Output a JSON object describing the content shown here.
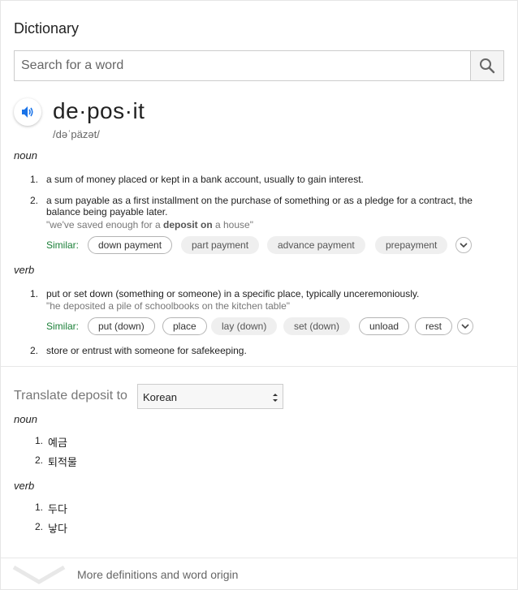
{
  "dictionary": {
    "title": "Dictionary",
    "search": {
      "placeholder": "Search for a word",
      "value": ""
    },
    "word": "de·pos·it",
    "phonetic": "/dəˈpäzət/",
    "noun": {
      "label": "noun",
      "defs": [
        {
          "num": "1.",
          "text": "a sum of money placed or kept in a bank account, usually to gain interest."
        },
        {
          "num": "2.",
          "text": "a sum payable as a first installment on the purchase of something or as a pledge for a contract, the balance being payable later.",
          "example_pre": "\"we've saved enough for a ",
          "example_bold": "deposit on",
          "example_post": " a house\"",
          "similar_label": "Similar:",
          "similar": [
            "down payment",
            "part payment",
            "advance payment",
            "prepayment"
          ]
        }
      ]
    },
    "verb": {
      "label": "verb",
      "defs": [
        {
          "num": "1.",
          "text": "put or set down (something or someone) in a specific place, typically unceremoniously.",
          "example": "\"he deposited a pile of schoolbooks on the kitchen table\"",
          "similar_label": "Similar:",
          "similar": [
            "put (down)",
            "place",
            "lay (down)",
            "set (down)",
            "unload",
            "rest"
          ]
        },
        {
          "num": "2.",
          "text": "store or entrust with someone for safekeeping."
        }
      ]
    }
  },
  "translate": {
    "label": "Translate deposit to",
    "language": "Korean",
    "noun": {
      "label": "noun",
      "items": [
        {
          "num": "1.",
          "text": "예금"
        },
        {
          "num": "2.",
          "text": "퇴적물"
        }
      ]
    },
    "verb": {
      "label": "verb",
      "items": [
        {
          "num": "1.",
          "text": "두다"
        },
        {
          "num": "2.",
          "text": "낳다"
        }
      ]
    }
  },
  "footer": {
    "more_label": "More definitions and word origin"
  },
  "colors": {
    "similar": "#1a7f37",
    "speaker": "#1a73e8"
  }
}
